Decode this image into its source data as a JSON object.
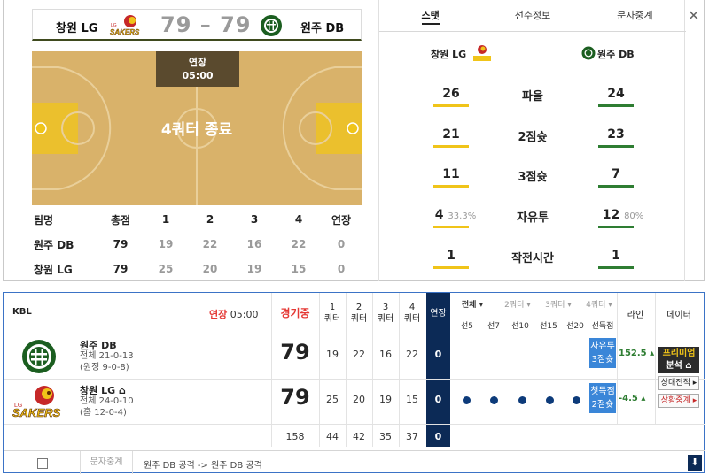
{
  "scoreboard": {
    "home_name": "창원 LG",
    "score": "79 – 79",
    "away_name": "원주 DB"
  },
  "court": {
    "ot_label": "연장",
    "ot_time": "05:00",
    "status": "4쿼터 종료"
  },
  "box": {
    "headers": [
      "팀명",
      "총점",
      "1",
      "2",
      "3",
      "4",
      "연장"
    ],
    "rows": [
      {
        "team": "원주 DB",
        "total": "79",
        "q1": "19",
        "q2": "22",
        "q3": "16",
        "q4": "22",
        "ot": "0"
      },
      {
        "team": "창원 LG",
        "total": "79",
        "q1": "25",
        "q2": "20",
        "q3": "19",
        "q4": "15",
        "ot": "0"
      }
    ]
  },
  "tabs": [
    "스탯",
    "선수정보",
    "문자중계"
  ],
  "close_icon": "✕",
  "compare": {
    "home": "창원 LG",
    "away": "원주 DB",
    "rows": [
      {
        "label": "파울",
        "home": "26",
        "away": "24"
      },
      {
        "label": "2점슛",
        "home": "21",
        "away": "23"
      },
      {
        "label": "3점슛",
        "home": "11",
        "away": "7"
      },
      {
        "label": "자유투",
        "home": "4",
        "home_pct": "33.3%",
        "away": "12",
        "away_pct": "80%"
      },
      {
        "label": "작전시간",
        "home": "1",
        "away": "1"
      }
    ]
  },
  "board": {
    "league": "KBL",
    "ot_label": "연장",
    "ot_time": "05:00",
    "game_status": "경기중",
    "quarter_headers": [
      "1\n쿼터",
      "2\n쿼터",
      "3\n쿼터",
      "4\n쿼터"
    ],
    "ot_header": "연장",
    "filters": [
      "전체 ▾",
      "2쿼터 ▾",
      "3쿼터 ▾",
      "4쿼터 ▾"
    ],
    "sub_headers": [
      "선5",
      "선7",
      "선10",
      "선15",
      "선20",
      "선득점"
    ],
    "line_header": "라인",
    "data_header": "데이터",
    "teams": [
      {
        "name": "원주 DB",
        "record1": "전체 21-0-13",
        "record2": "(원정 9-0-8)",
        "total": "79",
        "quarters": [
          "19",
          "22",
          "16",
          "22"
        ],
        "ot": "0",
        "badge": "자유투\n3점슛",
        "line": "152.5 ▴"
      },
      {
        "name": "창원 LG ⌂",
        "record1": "전체 24-0-10",
        "record2": "(홈 12-0-4)",
        "total": "79",
        "quarters": [
          "25",
          "20",
          "19",
          "15"
        ],
        "ot": "0",
        "badge": "첫득점\n2점슛",
        "line": "-4.5 ▴"
      }
    ],
    "totals": {
      "total": "158",
      "quarters": [
        "44",
        "42",
        "35",
        "37"
      ],
      "ot": "0"
    },
    "premium_1": "프리미엄",
    "premium_2": "분석 ⌂",
    "btn_vs": "상대전적 ▸",
    "btn_live": "상황중계 ▸",
    "foot_tab": "문자중계",
    "foot_text": "원주 DB 공격 -> 원주 DB 공격",
    "scroll_icon": "⬇"
  },
  "colors": {
    "lg_accent": "#f0c419",
    "db_accent": "#2e7d32",
    "court": "#d9b26a",
    "ot_column": "#0c2a56",
    "status_red": "#e53935"
  }
}
